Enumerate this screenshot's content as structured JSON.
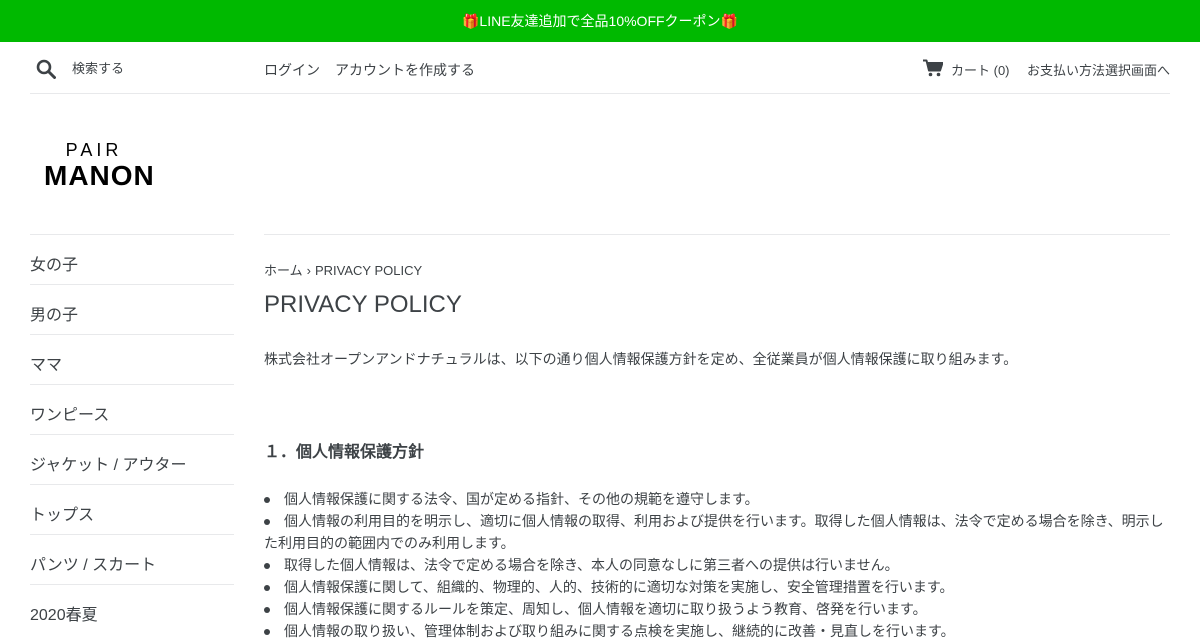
{
  "announcement": "🎁LINE友達追加で全品10%OFFクーポン🎁",
  "header": {
    "search_placeholder": "検索する",
    "login": "ログイン",
    "create_account": "アカウントを作成する",
    "cart": "カート (0)",
    "payment_link": "お支払い方法選択画面へ",
    "icons": [
      "search-icon",
      "cart-icon"
    ]
  },
  "logo": {
    "top": "PAIR",
    "main": "MANON"
  },
  "sidebar": {
    "items": [
      {
        "label": "女の子"
      },
      {
        "label": "男の子"
      },
      {
        "label": "ママ"
      },
      {
        "label": "ワンピース"
      },
      {
        "label": "ジャケット / アウター"
      },
      {
        "label": "トップス"
      },
      {
        "label": "パンツ / スカート"
      },
      {
        "label": "2020春夏"
      }
    ]
  },
  "breadcrumb": {
    "home": "ホーム",
    "separator": "›",
    "current": "PRIVACY POLICY"
  },
  "page": {
    "title": "PRIVACY POLICY",
    "intro": "株式会社オープンアンドナチュラルは、以下の通り個人情報保護方針を定め、全従業員が個人情報保護に取り組みます。",
    "section1_heading": "１．個人情報保護方針",
    "policies": [
      "個人情報保護に関する法令、国が定める指針、その他の規範を遵守します。",
      "個人情報の利用目的を明示し、適切に個人情報の取得、利用および提供を行います。取得した個人情報は、法令で定める場合を除き、明示した利用目的の範囲内でのみ利用します。",
      "取得した個人情報は、法令で定める場合を除き、本人の同意なしに第三者への提供は行いません。",
      "個人情報保護に関して、組織的、物理的、人的、技術的に適切な対策を実施し、安全管理措置を行います。",
      "個人情報保護に関するルールを策定、周知し、個人情報を適切に取り扱うよう教育、啓発を行います。",
      "個人情報の取り扱い、管理体制および取り組みに関する点検を実施し、継続的に改善・見直しを行います。"
    ]
  },
  "colors": {
    "announcement_bg": "#00b900",
    "text": "#3d4246",
    "border": "#e8e9eb"
  }
}
